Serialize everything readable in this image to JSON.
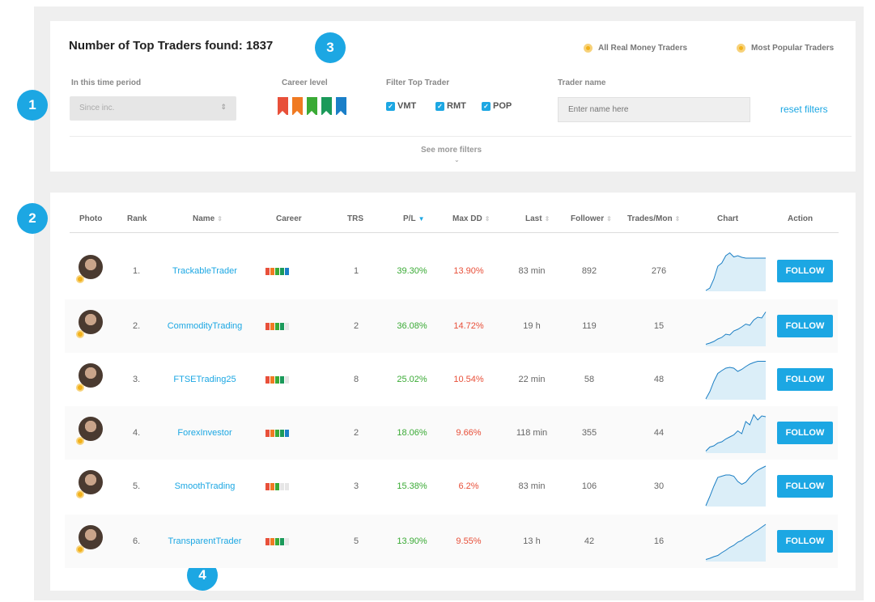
{
  "header": {
    "found_label": "Number of Top Traders found: 1837",
    "options": [
      "All Real Money Traders",
      "Most Popular Traders"
    ]
  },
  "markers": [
    "1",
    "2",
    "3",
    "4"
  ],
  "filters": {
    "period_label": "In this time period",
    "period_value": "Since inc.",
    "career_label": "Career level",
    "career_colors": [
      "#e8503a",
      "#f07a22",
      "#3aaa35",
      "#1b9a5a",
      "#1a7fc8"
    ],
    "filter_label": "Filter Top Trader",
    "checkboxes": [
      "VMT",
      "RMT",
      "POP"
    ],
    "trader_name_label": "Trader name",
    "trader_name_placeholder": "Enter name here",
    "reset_label": "reset filters",
    "more_filters": "See more filters"
  },
  "table": {
    "columns": [
      "Photo",
      "Rank",
      "Name",
      "Career",
      "TRS",
      "P/L",
      "Max DD",
      "Last",
      "Follower",
      "Trades/Mon",
      "Chart",
      "Action"
    ],
    "rows": [
      {
        "rank": "1.",
        "name": "TrackableTrader",
        "trs": "1",
        "pl": "39.30%",
        "maxdd": "13.90%",
        "last": "83 min",
        "follower": "892",
        "trades": "276",
        "action": "FOLLOW",
        "career_level": 5,
        "chart": [
          2,
          8,
          30,
          62,
          70,
          88,
          95,
          85,
          88,
          84,
          82,
          82,
          82,
          82,
          82,
          82
        ]
      },
      {
        "rank": "2.",
        "name": "CommodityTrading",
        "trs": "2",
        "pl": "36.08%",
        "maxdd": "14.72%",
        "last": "19 h",
        "follower": "119",
        "trades": "15",
        "action": "FOLLOW",
        "career_level": 4,
        "chart": [
          5,
          8,
          12,
          18,
          22,
          30,
          28,
          38,
          42,
          48,
          55,
          52,
          65,
          72,
          70,
          85
        ]
      },
      {
        "rank": "3.",
        "name": "FTSETrading25",
        "trs": "8",
        "pl": "25.02%",
        "maxdd": "10.54%",
        "last": "22 min",
        "follower": "58",
        "trades": "48",
        "action": "FOLLOW",
        "career_level": 4,
        "chart": [
          2,
          20,
          45,
          65,
          72,
          78,
          80,
          78,
          70,
          75,
          82,
          88,
          92,
          95,
          95,
          95
        ]
      },
      {
        "rank": "4.",
        "name": "ForexInvestor",
        "trs": "2",
        "pl": "18.06%",
        "maxdd": "9.66%",
        "last": "118 min",
        "follower": "355",
        "trades": "44",
        "action": "FOLLOW",
        "career_level": 5,
        "chart": [
          5,
          15,
          18,
          25,
          28,
          35,
          40,
          45,
          55,
          48,
          78,
          70,
          95,
          82,
          92,
          90
        ]
      },
      {
        "rank": "5.",
        "name": "SmoothTrading",
        "trs": "3",
        "pl": "15.38%",
        "maxdd": "6.2%",
        "last": "83 min",
        "follower": "106",
        "trades": "30",
        "action": "FOLLOW",
        "career_level": 3,
        "chart": [
          2,
          25,
          50,
          72,
          75,
          78,
          78,
          75,
          62,
          55,
          60,
          72,
          82,
          90,
          95,
          100
        ]
      },
      {
        "rank": "6.",
        "name": "TransparentTrader",
        "trs": "5",
        "pl": "13.90%",
        "maxdd": "9.55%",
        "last": "13 h",
        "follower": "42",
        "trades": "16",
        "action": "FOLLOW",
        "career_level": 4,
        "chart": [
          5,
          8,
          12,
          15,
          22,
          28,
          35,
          40,
          48,
          52,
          60,
          65,
          72,
          78,
          85,
          92
        ]
      }
    ]
  },
  "colors": {
    "accent": "#1ca7e3",
    "positive": "#3aaa35",
    "negative": "#e8503a",
    "star": "#f2b11a"
  }
}
